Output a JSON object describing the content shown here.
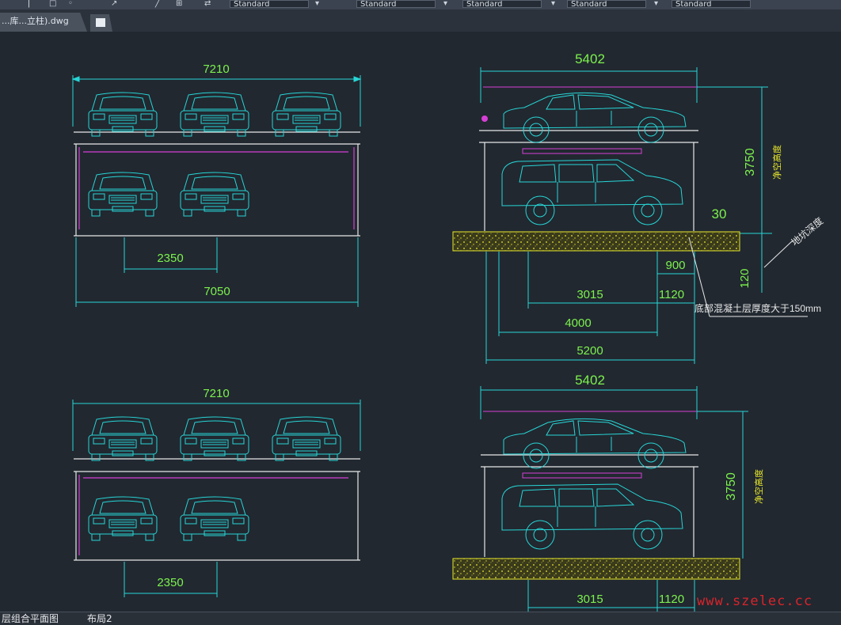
{
  "toolbar": {
    "styles": [
      "Standard",
      "Standard",
      "Standard",
      "Standard",
      "Standard"
    ]
  },
  "tabs": {
    "document_tab": "...库...立柱).dwg",
    "new_tab_icon": "new-document-icon"
  },
  "layout_tabs": {
    "model": "层组合平面图",
    "layout2": "布局2"
  },
  "drawing": {
    "plan_top": {
      "overall_width": "7210",
      "car_spacing": "2350",
      "base_width": "7050"
    },
    "plan_bottom": {
      "overall_width": "7210",
      "car_spacing": "2350"
    },
    "section_top": {
      "top_width": "5402",
      "height": "3750",
      "height_note": "净空高度",
      "pit_small": "30",
      "pit_depth": "120",
      "pit_note": "地坑深度",
      "dim_900": "900",
      "dim_3015": "3015",
      "dim_1120": "1120",
      "dim_4000": "4000",
      "dim_5200": "5200",
      "concrete_note": "底部混凝土层厚度大于150mm"
    },
    "section_bottom": {
      "top_width": "5402",
      "height": "3750",
      "height_note": "净空高度",
      "dim_3015": "3015",
      "dim_1120": "1120"
    }
  },
  "watermark": "www.szelec.cc",
  "colors": {
    "background": "#212830",
    "cyan": "#27d6d6",
    "white": "#e8e8e8",
    "magenta": "#d63fd6",
    "green_text": "#7cf24d",
    "yellow": "#e6e62a"
  }
}
